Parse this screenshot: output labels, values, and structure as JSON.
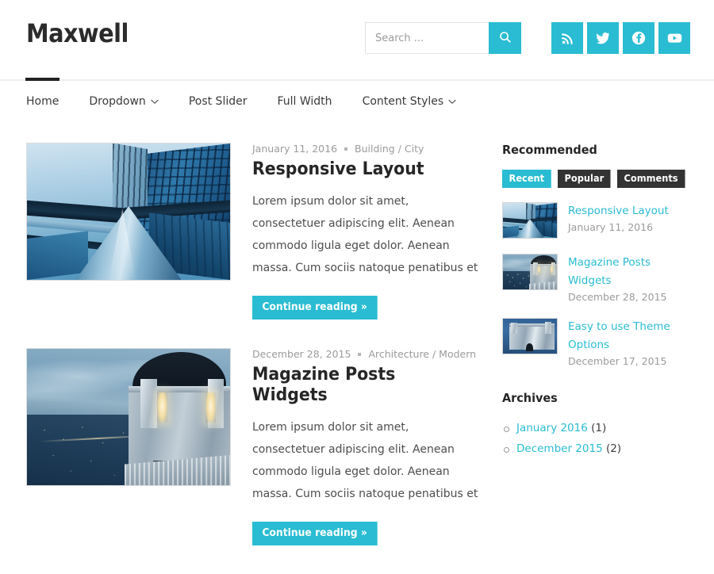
{
  "header": {
    "site_title": "Maxwell",
    "search": {
      "placeholder": "Search ...",
      "value": "",
      "icon": "search-icon"
    },
    "social": [
      {
        "name": "rss",
        "label": "RSS"
      },
      {
        "name": "twitter",
        "label": "Twitter"
      },
      {
        "name": "facebook",
        "label": "Facebook"
      },
      {
        "name": "youtube",
        "label": "YouTube"
      }
    ]
  },
  "nav": {
    "items": [
      {
        "label": "Home",
        "active": true,
        "has_dropdown": false
      },
      {
        "label": "Dropdown",
        "active": false,
        "has_dropdown": true
      },
      {
        "label": "Post Slider",
        "active": false,
        "has_dropdown": false
      },
      {
        "label": "Full Width",
        "active": false,
        "has_dropdown": false
      },
      {
        "label": "Content Styles",
        "active": false,
        "has_dropdown": true
      }
    ]
  },
  "posts": [
    {
      "date": "January 11, 2016",
      "categories": "Building / City",
      "title": "Responsive Layout",
      "excerpt": "Lorem ipsum dolor sit amet, consectetuer adipiscing elit. Aenean commodo ligula eget dolor. Aenean massa. Cum sociis natoque penatibus et",
      "more_label": "Continue reading »",
      "image": "glass-skyscraper-looking-up"
    },
    {
      "date": "December 28, 2015",
      "categories": "Architecture / Modern",
      "title": "Magazine Posts Widgets",
      "excerpt": "Lorem ipsum dolor sit amet, consectetuer adipiscing elit. Aenean commodo ligula eget dolor. Aenean massa. Cum sociis natoque penatibus et",
      "more_label": "Continue reading »",
      "image": "observatory-at-dusk-over-city"
    }
  ],
  "sidebar": {
    "recommended": {
      "title": "Recommended",
      "tabs": [
        {
          "label": "Recent",
          "active": true
        },
        {
          "label": "Popular",
          "active": false
        },
        {
          "label": "Comments",
          "active": false
        }
      ],
      "items": [
        {
          "title": "Responsive Layout",
          "date": "January 11, 2016",
          "image": "glass-skyscraper-thumb"
        },
        {
          "title": "Magazine Posts Widgets",
          "date": "December 28, 2015",
          "image": "observatory-thumb"
        },
        {
          "title": "Easy to use Theme Options",
          "date": "December 17, 2015",
          "image": "observatory-closeup-thumb"
        }
      ]
    },
    "archives": {
      "title": "Archives",
      "items": [
        {
          "label": "January 2016",
          "count": "(1)"
        },
        {
          "label": "December 2015",
          "count": "(2)"
        }
      ]
    }
  },
  "colors": {
    "accent": "#29bcd2",
    "dark": "#333333",
    "text": "#404040",
    "muted": "#9b9b9b",
    "border": "#efefef"
  }
}
